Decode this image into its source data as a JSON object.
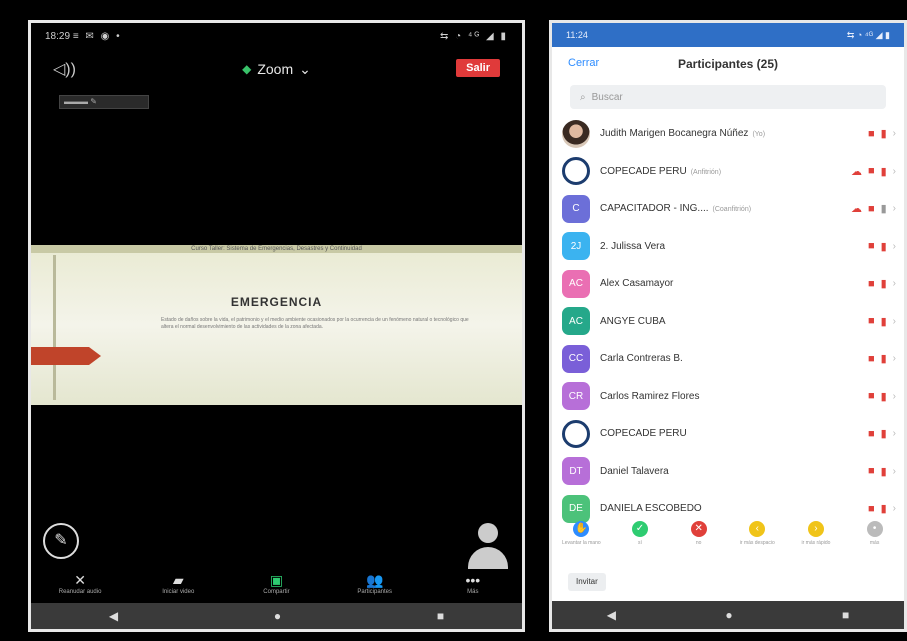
{
  "left": {
    "status_time": "18:29",
    "status_icons": "≡ ✉ ◉ •",
    "status_right": "⇆ ◔ ⁴ᴳ ◢ ▮",
    "speaker_icon": "speaker-icon",
    "zoom_title": "Zoom",
    "leave_label": "Salir",
    "slide": {
      "header": "Curso Taller: Sistema de Emergencias, Desastres y Continuidad",
      "title": "EMERGENCIA",
      "body": "Estado de daños sobre la vida, el patrimonio y el medio ambiente ocasionados por la ocurrencia de un fenómeno natural o tecnológico que altera el normal desenvolvimiento de las actividades de la zona afectada."
    },
    "toolbar": [
      {
        "icon": "mic-off-icon",
        "glyph": "✕",
        "label": "Reanudar audio"
      },
      {
        "icon": "video-off-icon",
        "glyph": "▰",
        "label": "Iniciar video"
      },
      {
        "icon": "share-icon",
        "glyph": "▣",
        "label": "Compartir"
      },
      {
        "icon": "participants-icon",
        "glyph": "👥",
        "label": "Participantes"
      },
      {
        "icon": "more-icon",
        "glyph": "•••",
        "label": "Más"
      }
    ]
  },
  "right": {
    "status_time": "11:24",
    "status_right": "⇆ ◔ ⁴ᴳ ◢ ▮",
    "close_label": "Cerrar",
    "title": "Participantes (25)",
    "search_placeholder": "Buscar",
    "participants": [
      {
        "initials": "",
        "type": "photo",
        "name": "Judith Marigen Bocanegra Núñez",
        "role": "(Yo)",
        "color": "#888888",
        "cloud": false,
        "mic_grey": false
      },
      {
        "initials": "",
        "type": "logo",
        "name": "COPECADE PERU",
        "role": "(Anfitrión)",
        "color": "#ffffff",
        "cloud": true,
        "mic_grey": false
      },
      {
        "initials": "C",
        "type": "initials",
        "name": "CAPACITADOR - ING....",
        "role": "(Coanfitrión)",
        "color": "#6c6fd8",
        "cloud": true,
        "mic_grey": true
      },
      {
        "initials": "2J",
        "type": "initials",
        "name": "2. Julissa Vera",
        "role": "",
        "color": "#3bb3f0",
        "cloud": false,
        "mic_grey": false
      },
      {
        "initials": "AC",
        "type": "initials",
        "name": "Alex Casamayor",
        "role": "",
        "color": "#ea6fb3",
        "cloud": false,
        "mic_grey": false
      },
      {
        "initials": "AC",
        "type": "initials",
        "name": "ANGYE CUBA",
        "role": "",
        "color": "#25a88a",
        "cloud": false,
        "mic_grey": false
      },
      {
        "initials": "CC",
        "type": "initials",
        "name": "Carla Contreras B.",
        "role": "",
        "color": "#7a5fd8",
        "cloud": false,
        "mic_grey": false
      },
      {
        "initials": "CR",
        "type": "initials",
        "name": "Carlos Ramirez Flores",
        "role": "",
        "color": "#b76fd8",
        "cloud": false,
        "mic_grey": false
      },
      {
        "initials": "",
        "type": "logo",
        "name": "COPECADE PERU",
        "role": "",
        "color": "#ffffff",
        "cloud": false,
        "mic_grey": false
      },
      {
        "initials": "DT",
        "type": "initials",
        "name": "Daniel Talavera",
        "role": "",
        "color": "#b76fd8",
        "cloud": false,
        "mic_grey": false
      },
      {
        "initials": "DE",
        "type": "initials",
        "name": "DANIELA ESCOBEDO",
        "role": "",
        "color": "#4cc27a",
        "cloud": false,
        "mic_grey": false
      }
    ],
    "reactions": [
      {
        "icon": "raise-hand-icon",
        "glyph": "✋",
        "label": "Levantar la mano",
        "color": "#2d8cff"
      },
      {
        "icon": "yes-icon",
        "glyph": "✓",
        "label": "sí",
        "color": "#2ecc71"
      },
      {
        "icon": "no-icon",
        "glyph": "✕",
        "label": "no",
        "color": "#e0403a"
      },
      {
        "icon": "slower-icon",
        "glyph": "‹",
        "label": "ir más despacio",
        "color": "#f0c419"
      },
      {
        "icon": "faster-icon",
        "glyph": "›",
        "label": "ir más rápido",
        "color": "#f0c419"
      },
      {
        "icon": "more-icon",
        "glyph": "•",
        "label": "más",
        "color": "#bbbbbb"
      }
    ],
    "invite_label": "Invitar"
  }
}
